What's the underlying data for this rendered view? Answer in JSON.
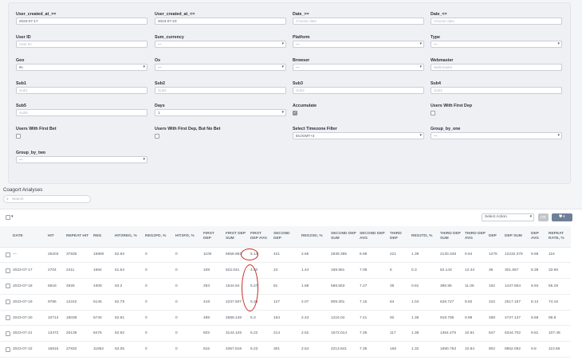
{
  "filters": [
    {
      "key": "user_created_from",
      "label": "User_created_at_>=",
      "value": "2023-07-17",
      "placeholder": "",
      "type": "text"
    },
    {
      "key": "user_created_to",
      "label": "User_created_at_<=",
      "value": "2023-07-23",
      "placeholder": "",
      "type": "text"
    },
    {
      "key": "date_from",
      "label": "Date_>=",
      "value": "",
      "placeholder": "Choose date",
      "type": "text"
    },
    {
      "key": "date_to",
      "label": "Date_<=",
      "value": "",
      "placeholder": "Choose date",
      "type": "text"
    },
    {
      "key": "user_id",
      "label": "User ID",
      "value": "",
      "placeholder": "User ID",
      "type": "text"
    },
    {
      "key": "sum_currency",
      "label": "Sum_currency",
      "value": "---",
      "placeholder": "",
      "type": "select"
    },
    {
      "key": "platform",
      "label": "Platform",
      "value": "---",
      "placeholder": "",
      "type": "select"
    },
    {
      "key": "type",
      "label": "Type",
      "value": "---",
      "placeholder": "",
      "type": "select"
    },
    {
      "key": "geo",
      "label": "Geo",
      "value": "IN",
      "placeholder": "",
      "type": "select"
    },
    {
      "key": "os",
      "label": "Os",
      "value": "---",
      "placeholder": "",
      "type": "select"
    },
    {
      "key": "browser",
      "label": "Browser",
      "value": "---",
      "placeholder": "",
      "type": "select"
    },
    {
      "key": "webmaster",
      "label": "Webmaster",
      "value": "",
      "placeholder": "Webmaster",
      "type": "text"
    },
    {
      "key": "sub1",
      "label": "Sub1",
      "value": "",
      "placeholder": "Sub1",
      "type": "text"
    },
    {
      "key": "sub2",
      "label": "Sub2",
      "value": "",
      "placeholder": "Sub2",
      "type": "text"
    },
    {
      "key": "sub3",
      "label": "Sub3",
      "value": "",
      "placeholder": "Sub3",
      "type": "text"
    },
    {
      "key": "sub4",
      "label": "Sub4",
      "value": "",
      "placeholder": "Sub4",
      "type": "text"
    },
    {
      "key": "sub5",
      "label": "Sub5",
      "value": "",
      "placeholder": "Sub5",
      "type": "text"
    },
    {
      "key": "days",
      "label": "Days",
      "value": "1",
      "placeholder": "",
      "type": "select"
    },
    {
      "key": "accumulate",
      "label": "Accumulate",
      "checked": true,
      "type": "checkbox"
    },
    {
      "key": "users_first_dep",
      "label": "Users With First Dep",
      "checked": false,
      "type": "checkbox"
    },
    {
      "key": "users_first_bet",
      "label": "Users With First Bet",
      "checked": false,
      "type": "checkbox"
    },
    {
      "key": "users_first_dep_no_bet",
      "label": "Users With First Dep, But No Bet",
      "checked": false,
      "type": "checkbox"
    },
    {
      "key": "timezone",
      "label": "Select Timezone Filter",
      "value": "Etc/GMT+3",
      "placeholder": "",
      "type": "select"
    },
    {
      "key": "group_by_one",
      "label": "Group_by_one",
      "value": "---",
      "placeholder": "",
      "type": "select"
    },
    {
      "key": "group_by_two",
      "label": "Group_by_two",
      "value": "---",
      "placeholder": "",
      "type": "select"
    }
  ],
  "section_title": "Coagort Analyses",
  "search_placeholder": "Search",
  "toolbar": {
    "select_action": "Select Action",
    "ok": "OK",
    "filter": "⛊ €"
  },
  "table": {
    "headers": [
      "DATE",
      "HIT",
      "REPEAT HIT",
      "REG",
      "HIT2REG, %",
      "REG2FD, %",
      "HIT2FD, %",
      "FIRST DEP",
      "FIRST DEP SUM",
      "FIRST DEP AVG",
      "SECOND DEP",
      "REG2SD, %",
      "SECOND DEP SUM",
      "SECOND DEP AVG",
      "THIRD DEP",
      "REG2TD, %",
      "THIRD DEP SUM",
      "THIRD DEP AVG",
      "DEP",
      "DEP SUM",
      "DEP AVG",
      "REPEAT RATE, %"
    ],
    "rows": [
      [
        "---",
        "25203",
        "37835",
        "15860",
        "62.93",
        "0",
        "0",
        "1100",
        "5658.953",
        "5.14",
        "421",
        "2.65",
        "2839.385",
        "6.98",
        "221",
        "1.39",
        "2130.348",
        "9.64",
        "1276",
        "12232.379",
        "9.59",
        "116"
      ],
      [
        "2023-07-17",
        "2704",
        "2411",
        "1664",
        "61.54",
        "0",
        "0",
        "108",
        "522.041",
        "4.92",
        "24",
        "1.44",
        "169.961",
        "7.08",
        "5",
        "0.3",
        "62.143",
        "12.43",
        "36",
        "301.557",
        "8.38",
        "33.96"
      ],
      [
        "2023-07-18",
        "6818",
        "4926",
        "4309",
        "63.2",
        "0",
        "0",
        "293",
        "1544.64",
        "5.27",
        "81",
        "1.88",
        "588.553",
        "7.27",
        "35",
        "0.81",
        "386.95",
        "11.06",
        "162",
        "1447.694",
        "8.94",
        "55.29"
      ],
      [
        "2023-07-19",
        "9786",
        "12242",
        "6145",
        "62.79",
        "0",
        "0",
        "418",
        "2237.507",
        "5.35",
        "127",
        "2.07",
        "909.301",
        "7.15",
        "64",
        "1.04",
        "628.727",
        "9.82",
        "310",
        "2517.157",
        "8.12",
        "74.16"
      ],
      [
        "2023-07-20",
        "10713",
        "18038",
        "6740",
        "62.91",
        "0",
        "0",
        "489",
        "2589.148",
        "5.3",
        "164",
        "2.43",
        "1216.04",
        "7.41",
        "92",
        "1.36",
        "918.795",
        "9.99",
        "488",
        "4727.137",
        "9.69",
        "99.8"
      ],
      [
        "2023-07-21",
        "13472",
        "20139",
        "8476",
        "62.92",
        "0",
        "0",
        "602",
        "3144.125",
        "5.22",
        "214",
        "2.52",
        "1572.014",
        "7.35",
        "117",
        "1.38",
        "1364.275",
        "10.91",
        "647",
        "6344.702",
        "9.81",
        "107.48"
      ],
      [
        "2023-07-22",
        "18815",
        "27832",
        "11862",
        "63.05",
        "0",
        "0",
        "816",
        "4367.818",
        "5.23",
        "301",
        "2.54",
        "2213.841",
        "7.35",
        "156",
        "1.32",
        "1690.753",
        "10.84",
        "902",
        "8852.092",
        "9.8",
        "110.86"
      ]
    ]
  }
}
